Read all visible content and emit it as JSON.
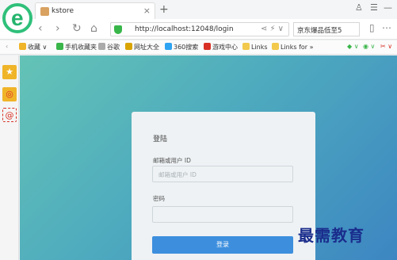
{
  "browser": {
    "logo_glyph": "e",
    "tab_title": "kstore",
    "tab_close": "×",
    "new_tab": "+",
    "url": "http://localhost:12048/login",
    "search_text": "京东爆品低至5",
    "colors": {
      "accent": "#2fc07a",
      "button": "#3d8fde"
    }
  },
  "bookmarks": [
    {
      "label": "收藏",
      "icon": "star-icon",
      "color": "#f0b429"
    },
    {
      "label": "手机收藏夹",
      "icon": "phone-icon",
      "color": "#39b54a"
    },
    {
      "label": "谷歌",
      "icon": "page-icon",
      "color": "#aaaaaa"
    },
    {
      "label": "网址大全",
      "icon": "globe-icon",
      "color": "#d9a400"
    },
    {
      "label": "360搜索",
      "icon": "search-engine-icon",
      "color": "#2ea3f2"
    },
    {
      "label": "游戏中心",
      "icon": "game-icon",
      "color": "#d93025"
    },
    {
      "label": "Links",
      "icon": "folder-icon",
      "color": "#f2c94c"
    },
    {
      "label": "Links for",
      "icon": "folder-icon",
      "color": "#f2c94c"
    }
  ],
  "login": {
    "title": "登陆",
    "user_label": "邮箱或用户 ID",
    "user_placeholder": "邮箱或用户 ID",
    "password_label": "密码",
    "submit": "登录"
  },
  "watermark": "最需教育"
}
